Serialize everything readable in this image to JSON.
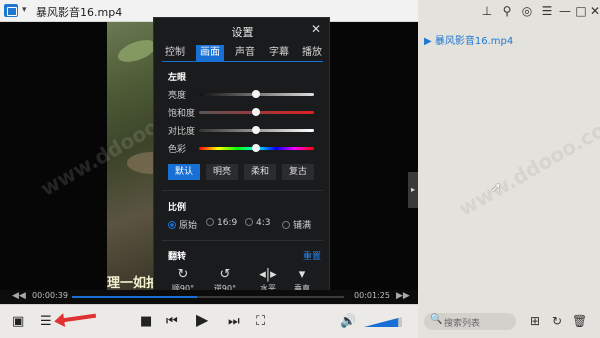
{
  "titlebar": {
    "filename": "暴风影音16.mp4",
    "caret": "▾",
    "pin_glyph": "⊥",
    "pin2_glyph": "⚲",
    "skin_glyph": "◎",
    "menu_glyph": "☰",
    "minimize_glyph": "—",
    "maximize_glyph": "□",
    "close_glyph": "✕"
  },
  "subtitle": "理一如拍",
  "side_handle_glyph": "▸",
  "settings": {
    "title": "设置",
    "close_glyph": "✕",
    "tabs": [
      {
        "label": "控制",
        "active": false
      },
      {
        "label": "画面",
        "active": true
      },
      {
        "label": "声音",
        "active": false
      },
      {
        "label": "字幕",
        "active": false
      },
      {
        "label": "播放",
        "active": false
      }
    ],
    "left_eye_section": "左眼",
    "sliders": [
      {
        "label": "亮度",
        "value": 0.5
      },
      {
        "label": "饱和度",
        "value": 0.5
      },
      {
        "label": "对比度",
        "value": 0.5
      },
      {
        "label": "色彩",
        "value": 0.5
      }
    ],
    "presets": [
      {
        "label": "默认",
        "active": true
      },
      {
        "label": "明亮",
        "active": false
      },
      {
        "label": "柔和",
        "active": false
      },
      {
        "label": "复古",
        "active": false
      }
    ],
    "ratio_section": "比例",
    "ratios": [
      {
        "label": "原始",
        "active": true
      },
      {
        "label": "16:9",
        "active": false
      },
      {
        "label": "4:3",
        "active": false
      },
      {
        "label": "铺满",
        "active": false
      }
    ],
    "flip_section": "翻转",
    "reset_label": "重置",
    "flips": [
      {
        "label": "顺90°",
        "icon": "↻"
      },
      {
        "label": "逆90°",
        "icon": "↺"
      },
      {
        "label": "水平",
        "icon": "◂|▸"
      },
      {
        "label": "垂直",
        "icon": "▾"
      }
    ]
  },
  "progress": {
    "elapsed": "00:00:39",
    "total": "00:01:25",
    "fraction": 0.46,
    "prev_glyph": "◀◀",
    "next_glyph": "▶▶"
  },
  "controls": {
    "toolbox_glyph": "▣",
    "list_glyph": "☰",
    "stop_glyph": "■",
    "prev_glyph": "⏮",
    "play_glyph": "▶",
    "next_glyph": "⏭",
    "fullscreen_glyph": "⛶",
    "volume_glyph": "🔊",
    "volume_level": 0.9
  },
  "playlist": {
    "items": [
      {
        "label": "▶ 暴风影音16.mp4"
      }
    ],
    "search_placeholder": "搜索列表",
    "search_glyph": "🔍",
    "add_glyph": "⊞",
    "loop_glyph": "↻",
    "delete_glyph": "🗑"
  },
  "watermark": "www.ddooo.com",
  "colors": {
    "accent": "#1870d4",
    "panel": "#1a1b1d",
    "playlist_text": "#1e78d2",
    "annotation_arrow": "#e03232"
  }
}
